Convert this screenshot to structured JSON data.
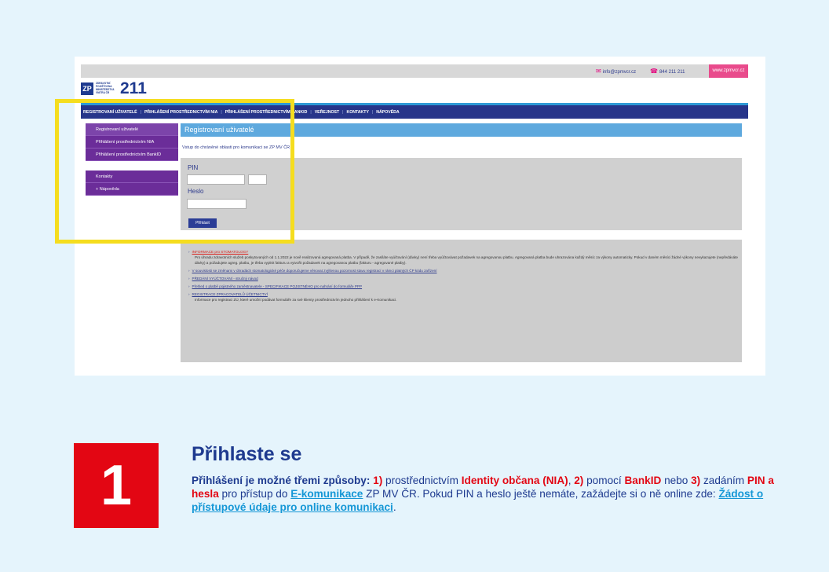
{
  "topbar": {
    "email": "info@zpmvcr.cz",
    "phone": "844 211 211",
    "web": "www.zpmvcr.cz"
  },
  "logo": {
    "mark": "ZP",
    "text": "ZDRAVOTNÍ POJIŠŤOVNA MINISTERSTVA VNITRA ČR",
    "number": "211"
  },
  "nav": {
    "items": [
      "REGISTROVANÍ UŽIVATELÉ",
      "PŘIHLÁŠENÍ PROSTŘEDNICTVÍM NIA",
      "PŘIHLÁŠENÍ PROSTŘEDNICTVÍM BANKID",
      "VEŘEJNOST",
      "KONTAKTY",
      "NÁPOVĚDA"
    ]
  },
  "sidebar": {
    "items": [
      {
        "label": "Registrovaní uživatelé"
      },
      {
        "label": "Přihlášení prostřednictvím NIA"
      },
      {
        "label": "Přihlášení prostřednictvím BankID"
      }
    ],
    "items2": [
      {
        "label": "Kontakty"
      },
      {
        "label": "+ Nápověda"
      }
    ]
  },
  "content": {
    "title": "Registrovaní uživatelé",
    "intro": "Vstup do chráněné oblasti pro komunikaci se ZP MV ČR",
    "pin_label": "PIN",
    "password_label": "Heslo",
    "login_button": "Přihlásit"
  },
  "info": {
    "items": [
      {
        "title": "INFORMACE pro STOMATOLOGY",
        "body": "Pro úhradu zdravotních služeb poskytovaných od 1.1.2022 je nově realizovaná agregovaná platba. V případě, že zasíláte vyúčtování (dávky) není třeba vyúčtovávat požadavek na agregovanou platbu. Agregovaná platba bude uhrazována každý měsíc za výkony automaticky. Pokud v daném měsíci žádné výkony nevykazujete (nepředáváte dávky) a požadujete agreg. platbu, je třeba vyplnit fakturu a vytvořit požadavek na agregovanou platbu (fakturu - agregované platby)."
      },
      {
        "title": "V souvislosti se změnami v úhradách stomatologické péče doporučujeme věnovat zvýšenou pozornost stavu registrací v rámci platných ČP kódu zařízení",
        "body": ""
      },
      {
        "title": "PŘEDÁNÍ VYÚČTOVÁNÍ - stručný návod",
        "body": ""
      },
      {
        "title": "Přehled o platbě pojistného zaměstnavatele - SPECIFIKACE POJISTNÉHO pro nahrání do formuláře PPP",
        "body": ""
      },
      {
        "title": "REGISTRACE ZPRACOVATELŮ ÚČETNICTVÍ",
        "body": "Informace pro registraci ZÚ, které umožní podávat formuláře za své klienty prostřednictvím jednoho přihlášení k e-Komunikaci."
      }
    ]
  },
  "step": {
    "number": "1",
    "heading": "Přihlaste se",
    "p1": "Přihlášení je možné třemi způsoby:",
    "p2": "1)",
    "p3": " prostřednictvím ",
    "p4": "Identity občana (NIA)",
    "p5": ", ",
    "p6": "2)",
    "p7": " pomocí ",
    "p8": "BankID",
    "p9": " nebo ",
    "p10": "3)",
    "p11": " zadáním ",
    "p12": "PIN a hesla",
    "p13": " pro přístup do ",
    "p14": "E-komunikace",
    "p15": " ZP MV ČR. Pokud PIN a heslo ještě nemáte, zažádejte si o ně online zde: ",
    "p16": "Žádost o přístupové údaje pro online komunikaci",
    "p17": "."
  },
  "colors": {
    "brand": "#1e3a8f",
    "accent_red": "#e30613",
    "highlight": "#f5dd1f",
    "sidebar": "#6b2d99"
  }
}
